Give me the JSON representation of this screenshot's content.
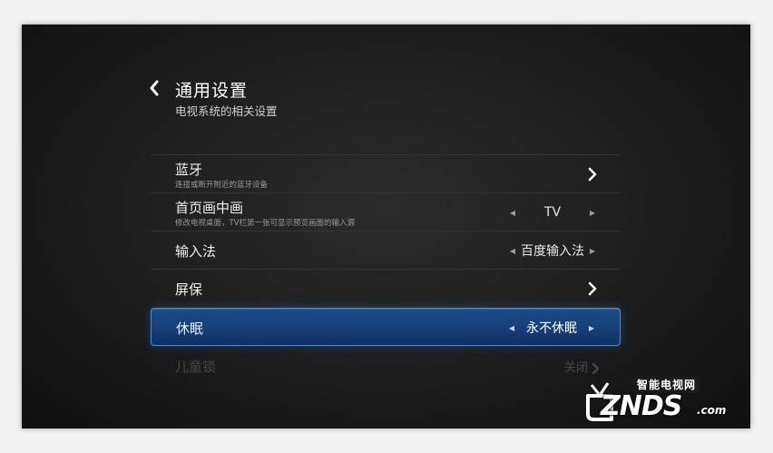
{
  "header": {
    "title": "通用设置",
    "subtitle": "电视系统的相关设置"
  },
  "settings": [
    {
      "label": "蓝牙",
      "desc": "连接或断开附近的蓝牙设备"
    },
    {
      "label": "首页画中画",
      "desc": "修改电视桌面，TV栏第一张可显示预览画面的输入源",
      "value": "TV"
    },
    {
      "label": "输入法",
      "value": "百度输入法"
    },
    {
      "label": "屏保"
    },
    {
      "label": "休眠",
      "value": "永不休眠",
      "selected": true
    },
    {
      "label": "儿童锁",
      "value": "关闭"
    }
  ],
  "watermark": {
    "top": "智能电视网",
    "main": "ZNDS",
    "suffix": ".com"
  },
  "colors": {
    "selected_fill": "#16407a",
    "selected_border": "#4d87c7"
  },
  "icons": {
    "back": "chevron-left-icon",
    "enter": "chevron-right-icon",
    "prev_value": "triangle-left-icon",
    "next_value": "triangle-right-icon"
  }
}
